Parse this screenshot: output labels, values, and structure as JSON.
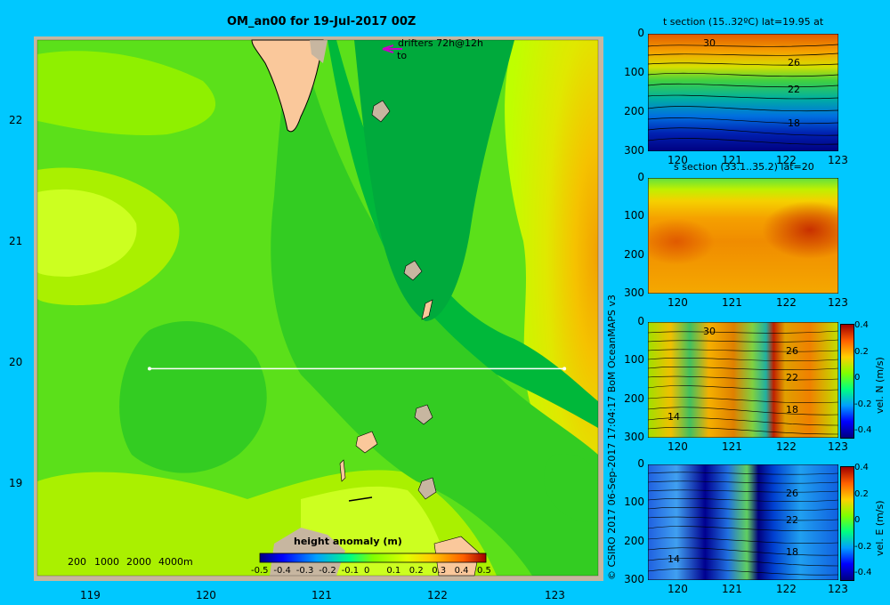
{
  "map": {
    "title": "OM_an00 for 19-Jul-2017 00Z",
    "drifters_label": "drifters 72h@12h",
    "drifters_to": "to",
    "x_ticks": [
      "119",
      "120",
      "121",
      "122",
      "123"
    ],
    "y_ticks": [
      "22",
      "21",
      "20",
      "19"
    ],
    "depth_legend": [
      "200",
      "1000",
      "2000",
      "4000m"
    ],
    "colorbar_title": "height anomaly (m)",
    "colorbar_ticks": [
      "-0.5",
      "-0.4",
      "-0.3",
      "-0.2",
      "-0.1",
      "0",
      "0.1",
      "0.2",
      "0.3",
      "0.4",
      "0.5"
    ]
  },
  "credit": "© CSIRO 2017   06-Sep-2017 17:04:17 BoM OceanMAPS v3",
  "panels": [
    {
      "title": "t section (15..32ºC) lat=19.95 at",
      "x_ticks": [
        "120",
        "121",
        "122",
        "123"
      ],
      "y_ticks": [
        "0",
        "100",
        "200",
        "300"
      ],
      "contour_labels": [
        "30",
        "26",
        "22",
        "18"
      ],
      "colorbar_label": "",
      "colorbar_ticks": []
    },
    {
      "title": "s section (33.1..35.2) lat=20",
      "x_ticks": [
        "120",
        "121",
        "122",
        "123"
      ],
      "y_ticks": [
        "0",
        "100",
        "200",
        "300"
      ],
      "contour_labels": [],
      "colorbar_label": "",
      "colorbar_ticks": []
    },
    {
      "title": "",
      "x_ticks": [
        "120",
        "121",
        "122",
        "123"
      ],
      "y_ticks": [
        "0",
        "100",
        "200",
        "300"
      ],
      "contour_labels": [
        "30",
        "26",
        "22",
        "18",
        "14"
      ],
      "colorbar_label": "vel. N (m/s)",
      "colorbar_ticks": [
        "0.4",
        "0.2",
        "0",
        "-0.2",
        "-0.4"
      ]
    },
    {
      "title": "",
      "x_ticks": [
        "120",
        "121",
        "122",
        "123"
      ],
      "y_ticks": [
        "0",
        "100",
        "200",
        "300"
      ],
      "contour_labels": [
        "26",
        "22",
        "18",
        "14"
      ],
      "colorbar_label": "vel. E (m/s)",
      "colorbar_ticks": [
        "0.4",
        "0.2",
        "0",
        "-0.2",
        "-0.4"
      ]
    }
  ],
  "chart_data": {
    "type": "heatmap",
    "title": "OM_an00 for 19-Jul-2017 00Z",
    "xlim": [
      118.5,
      123.5
    ],
    "ylim": [
      18.3,
      22.7
    ],
    "colorbar_range": [
      -0.5,
      0.5
    ],
    "section_line": {
      "lon": [
        119.5,
        123.2
      ],
      "lat": [
        20,
        20
      ]
    }
  }
}
